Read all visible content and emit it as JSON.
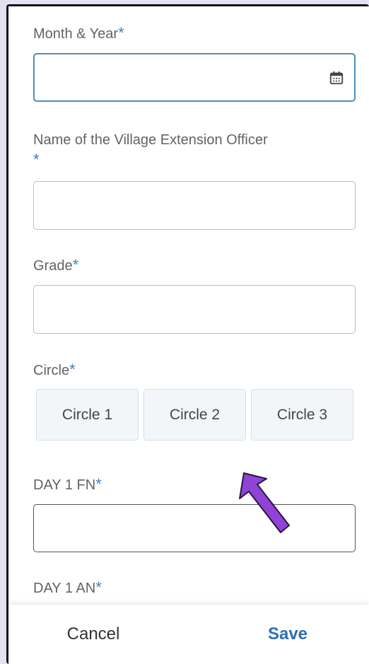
{
  "form": {
    "month_year": {
      "label": "Month & Year",
      "required": "*",
      "value": ""
    },
    "officer": {
      "label": "Name of the Village Extension Officer",
      "required": "*",
      "value": ""
    },
    "grade": {
      "label": "Grade",
      "required": "*",
      "value": ""
    },
    "circle": {
      "label": "Circle",
      "required": "*",
      "options": [
        "Circle 1",
        "Circle 2",
        "Circle 3"
      ]
    },
    "day1_fn": {
      "label": "DAY 1 FN",
      "required": "*",
      "value": ""
    },
    "day1_an": {
      "label": "DAY 1 AN",
      "required": "*"
    }
  },
  "footer": {
    "cancel_label": "Cancel",
    "save_label": "Save"
  },
  "colors": {
    "accent": "#3b82c4",
    "annotation_arrow": "#8e44d6",
    "background": "#e6e0f3"
  },
  "icons": {
    "date_picker": "calendar-icon",
    "annotation": "arrow-icon"
  }
}
